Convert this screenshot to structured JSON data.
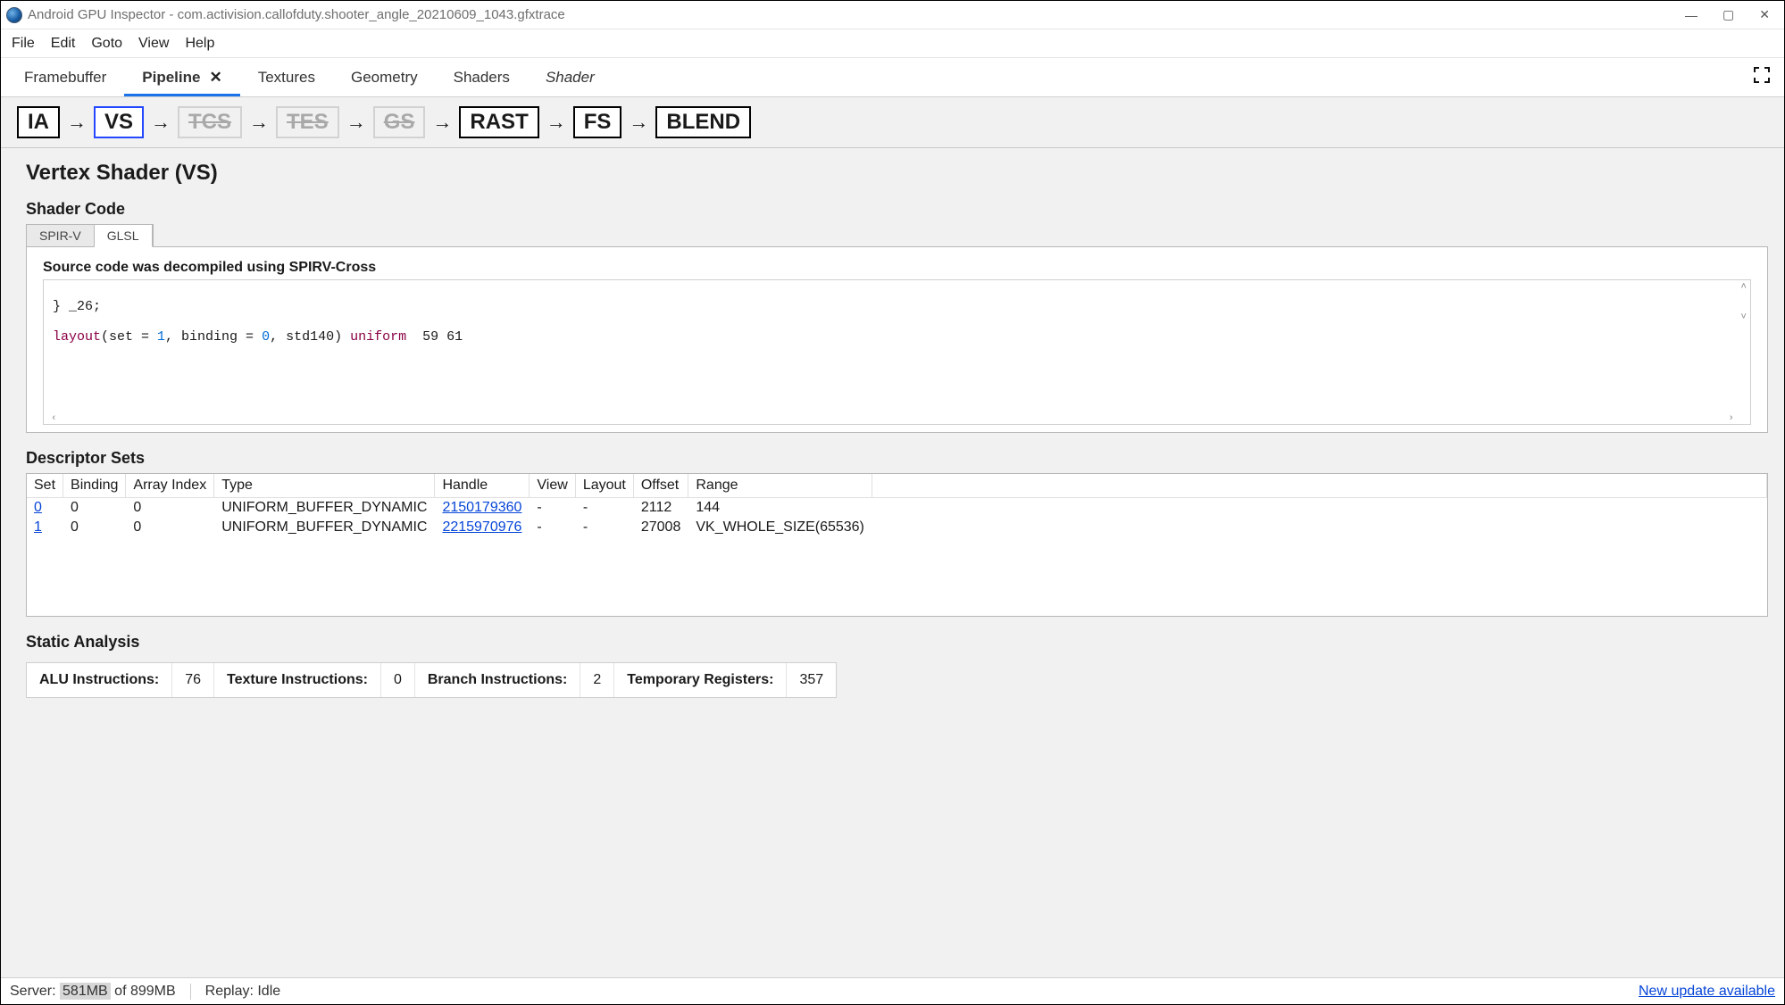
{
  "window": {
    "title": "Android GPU Inspector - com.activision.callofduty.shooter_angle_20210609_1043.gfxtrace"
  },
  "menu": {
    "items": [
      "File",
      "Edit",
      "Goto",
      "View",
      "Help"
    ]
  },
  "tabs": {
    "items": [
      {
        "label": "Framebuffer",
        "active": false,
        "closable": false,
        "italic": false
      },
      {
        "label": "Pipeline",
        "active": true,
        "closable": true,
        "italic": false
      },
      {
        "label": "Textures",
        "active": false,
        "closable": false,
        "italic": false
      },
      {
        "label": "Geometry",
        "active": false,
        "closable": false,
        "italic": false
      },
      {
        "label": "Shaders",
        "active": false,
        "closable": false,
        "italic": false
      },
      {
        "label": "Shader",
        "active": false,
        "closable": false,
        "italic": true
      }
    ]
  },
  "pipeline": {
    "stages": [
      {
        "label": "IA",
        "state": "normal"
      },
      {
        "label": "VS",
        "state": "selected"
      },
      {
        "label": "TCS",
        "state": "disabled"
      },
      {
        "label": "TES",
        "state": "disabled"
      },
      {
        "label": "GS",
        "state": "disabled"
      },
      {
        "label": "RAST",
        "state": "normal"
      },
      {
        "label": "FS",
        "state": "normal"
      },
      {
        "label": "BLEND",
        "state": "normal"
      }
    ]
  },
  "main": {
    "title": "Vertex Shader (VS)",
    "shader_code": {
      "title": "Shader Code",
      "tabs": {
        "spirv": "SPIR-V",
        "glsl": "GLSL",
        "active": "glsl"
      },
      "note": "Source code was decompiled using SPIRV-Cross",
      "code_line1": "} _26;",
      "code_line2_pre": "layout",
      "code_line2_mid1": "(set = ",
      "code_line2_n1": "1",
      "code_line2_mid2": ", binding = ",
      "code_line2_n2": "0",
      "code_line2_mid3": ", std140) ",
      "code_line2_kw": "uniform",
      "code_line2_tail": "  59 61"
    },
    "descriptor": {
      "title": "Descriptor Sets",
      "headers": [
        "Set",
        "Binding",
        "Array Index",
        "Type",
        "Handle",
        "View",
        "Layout",
        "Offset",
        "Range"
      ],
      "rows": [
        {
          "set": "0",
          "binding": "0",
          "array_index": "0",
          "type": "UNIFORM_BUFFER_DYNAMIC",
          "handle": "2150179360",
          "view": "-",
          "layout": "-",
          "offset": "2112",
          "range": "144"
        },
        {
          "set": "1",
          "binding": "0",
          "array_index": "0",
          "type": "UNIFORM_BUFFER_DYNAMIC",
          "handle": "2215970976",
          "view": "-",
          "layout": "-",
          "offset": "27008",
          "range": "VK_WHOLE_SIZE(65536)"
        }
      ]
    },
    "static_analysis": {
      "title": "Static Analysis",
      "alu_label": "ALU Instructions:",
      "alu_value": "76",
      "tex_label": "Texture Instructions:",
      "tex_value": "0",
      "branch_label": "Branch Instructions:",
      "branch_value": "2",
      "temp_label": "Temporary Registers:",
      "temp_value": "357"
    }
  },
  "status": {
    "server_label": "Server: ",
    "server_used": "581MB",
    "server_total": " of 899MB",
    "replay_label": "Replay: ",
    "replay_state": "Idle",
    "update": "New update available"
  }
}
